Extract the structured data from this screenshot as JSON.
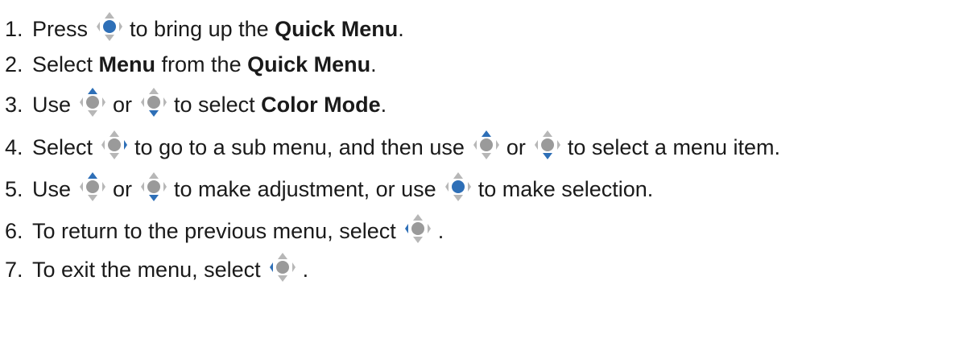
{
  "colors": {
    "active": "#2e6fb7",
    "inactive": "#b7b7b7",
    "center_inactive": "#9a9a9a"
  },
  "steps": [
    {
      "num": "1.",
      "parts": [
        {
          "kind": "text",
          "text": "Press"
        },
        {
          "kind": "icon",
          "icon": "joystick-press-icon",
          "active": "center"
        },
        {
          "kind": "text",
          "text": "to bring up the "
        },
        {
          "kind": "bold",
          "text": "Quick Menu"
        },
        {
          "kind": "text",
          "text": "."
        }
      ]
    },
    {
      "num": "2.",
      "parts": [
        {
          "kind": "text",
          "text": "Select "
        },
        {
          "kind": "bold",
          "text": "Menu"
        },
        {
          "kind": "text",
          "text": " from the "
        },
        {
          "kind": "bold",
          "text": "Quick Menu"
        },
        {
          "kind": "text",
          "text": "."
        }
      ]
    },
    {
      "num": "3.",
      "parts": [
        {
          "kind": "text",
          "text": "Use"
        },
        {
          "kind": "icon",
          "icon": "joystick-up-icon",
          "active": "up"
        },
        {
          "kind": "text",
          "text": "or"
        },
        {
          "kind": "icon",
          "icon": "joystick-down-icon",
          "active": "down"
        },
        {
          "kind": "text",
          "text": "to select "
        },
        {
          "kind": "bold",
          "text": "Color Mode"
        },
        {
          "kind": "text",
          "text": "."
        }
      ]
    },
    {
      "num": "4.",
      "parts": [
        {
          "kind": "text",
          "text": "Select"
        },
        {
          "kind": "icon",
          "icon": "joystick-right-icon",
          "active": "right"
        },
        {
          "kind": "text",
          "text": "to go to a sub menu, and then use"
        },
        {
          "kind": "icon",
          "icon": "joystick-up-icon",
          "active": "up"
        },
        {
          "kind": "text",
          "text": "or"
        },
        {
          "kind": "icon",
          "icon": "joystick-down-icon",
          "active": "down"
        },
        {
          "kind": "text",
          "text": "to select a menu item."
        }
      ]
    },
    {
      "num": "5.",
      "parts": [
        {
          "kind": "text",
          "text": "Use"
        },
        {
          "kind": "icon",
          "icon": "joystick-up-icon",
          "active": "up"
        },
        {
          "kind": "text",
          "text": "or"
        },
        {
          "kind": "icon",
          "icon": "joystick-down-icon",
          "active": "down"
        },
        {
          "kind": "text",
          "text": "to make adjustment, or use"
        },
        {
          "kind": "icon",
          "icon": "joystick-press-icon",
          "active": "center"
        },
        {
          "kind": "text",
          "text": "to make selection."
        }
      ]
    },
    {
      "num": "6.",
      "parts": [
        {
          "kind": "text",
          "text": "To return to the previous menu, select"
        },
        {
          "kind": "icon",
          "icon": "joystick-left-icon",
          "active": "left"
        },
        {
          "kind": "text",
          "text": "."
        }
      ]
    },
    {
      "num": "7.",
      "parts": [
        {
          "kind": "text",
          "text": "To exit the menu, select"
        },
        {
          "kind": "icon",
          "icon": "joystick-left-icon",
          "active": "left"
        },
        {
          "kind": "text",
          "text": "."
        }
      ]
    }
  ]
}
